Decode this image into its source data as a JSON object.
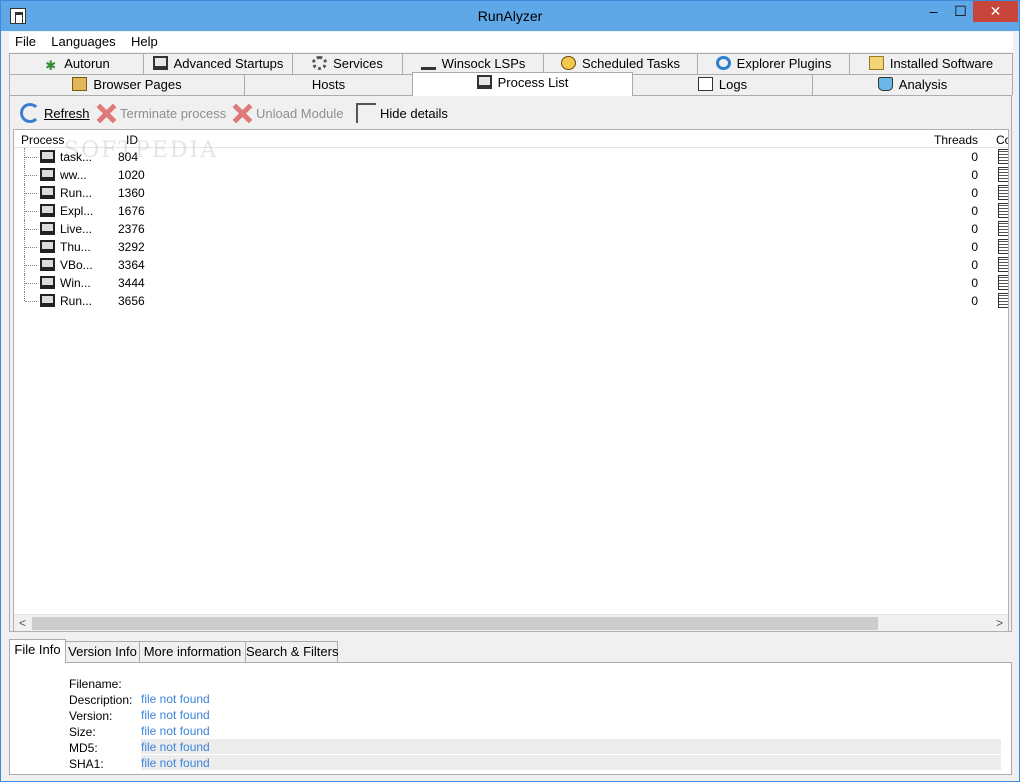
{
  "window": {
    "title": "RunAlyzer",
    "minimize_glyph": "–",
    "maximize_glyph": "☐",
    "close_glyph": "✕"
  },
  "menu": [
    "File",
    "Languages",
    "Help"
  ],
  "tabs_row1": [
    {
      "label": "Autorun",
      "icon": "star-icon"
    },
    {
      "label": "Advanced Startups",
      "icon": "monitor-icon"
    },
    {
      "label": "Services",
      "icon": "gear-icon"
    },
    {
      "label": "Winsock LSPs",
      "icon": "plug-icon"
    },
    {
      "label": "Scheduled Tasks",
      "icon": "clock-icon"
    },
    {
      "label": "Explorer Plugins",
      "icon": "ie-icon"
    },
    {
      "label": "Installed Software",
      "icon": "box-icon"
    }
  ],
  "tabs_row2": [
    {
      "label": "Browser Pages",
      "icon": "house-icon"
    },
    {
      "label": "Hosts",
      "icon": ""
    },
    {
      "label": "Process List",
      "icon": "monitor-icon",
      "active": true
    },
    {
      "label": "Logs",
      "icon": "document-icon"
    },
    {
      "label": "Analysis",
      "icon": "flask-icon"
    }
  ],
  "toolbar": {
    "refresh": "Refresh",
    "terminate": "Terminate process",
    "unload": "Unload Module",
    "hide_details": "Hide details"
  },
  "process_list": {
    "columns": {
      "process": "Process",
      "id": "ID",
      "threads": "Threads",
      "extra": "Co"
    },
    "rows": [
      {
        "name": "task...",
        "id": "804",
        "threads": "0"
      },
      {
        "name": "ww...",
        "id": "1020",
        "threads": "0"
      },
      {
        "name": "Run...",
        "id": "1360",
        "threads": "0"
      },
      {
        "name": "Expl...",
        "id": "1676",
        "threads": "0"
      },
      {
        "name": "Live...",
        "id": "2376",
        "threads": "0"
      },
      {
        "name": "Thu...",
        "id": "3292",
        "threads": "0"
      },
      {
        "name": "VBo...",
        "id": "3364",
        "threads": "0"
      },
      {
        "name": "Win...",
        "id": "3444",
        "threads": "0"
      },
      {
        "name": "Run...",
        "id": "3656",
        "threads": "0"
      }
    ],
    "watermark": "SOFTPEDIA"
  },
  "scrollbar": {
    "left": "<",
    "right": ">"
  },
  "detail_tabs": [
    "File Info",
    "Version Info",
    "More information",
    "Search & Filters"
  ],
  "file_info": [
    {
      "key": "Filename:",
      "value": ""
    },
    {
      "key": "Description:",
      "value": "file not found"
    },
    {
      "key": "Version:",
      "value": "file not found"
    },
    {
      "key": "Size:",
      "value": "file not found"
    },
    {
      "key": "MD5:",
      "value": "file not found"
    },
    {
      "key": "SHA1:",
      "value": "file not found"
    }
  ]
}
